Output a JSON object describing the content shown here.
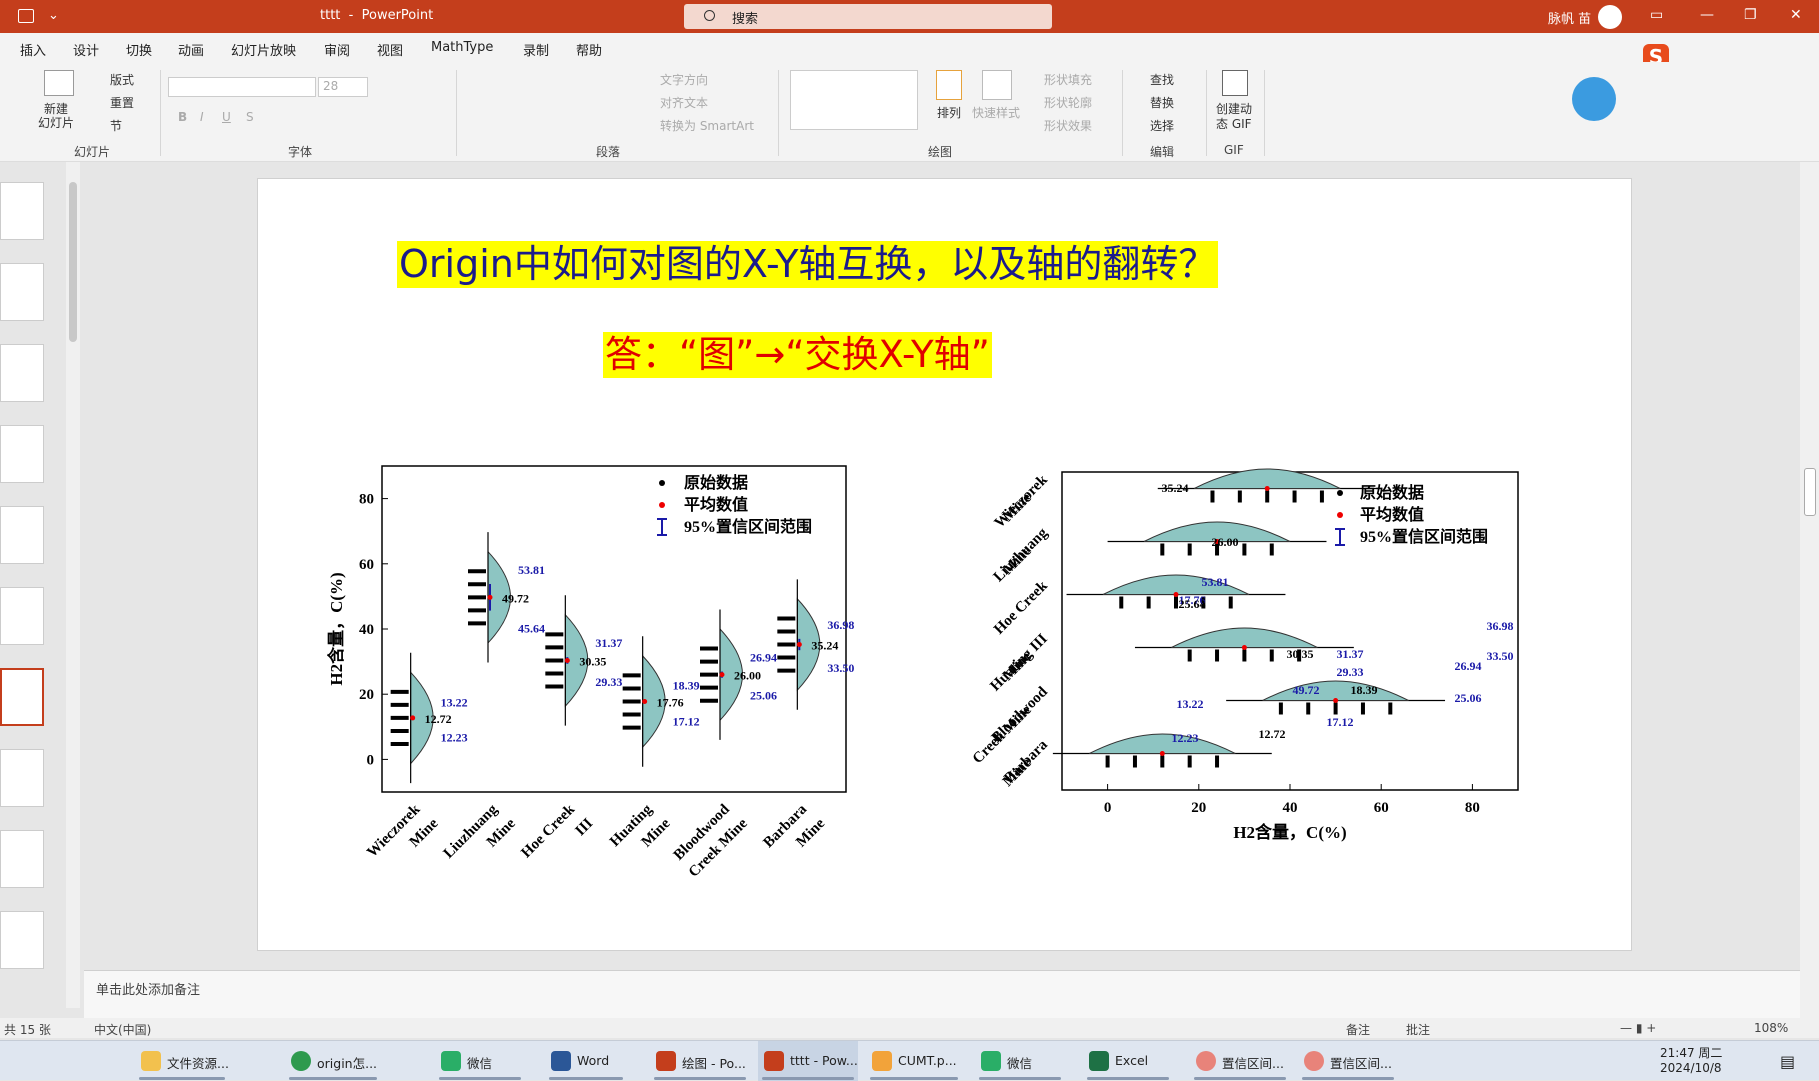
{
  "titlebar": {
    "doc_title": "tttt  -  PowerPoint",
    "search_placeholder": "搜索",
    "user_name": "脉帆 苗"
  },
  "menu": [
    "插入",
    "设计",
    "切换",
    "动画",
    "幻灯片放映",
    "审阅",
    "视图",
    "MathType",
    "录制",
    "帮助"
  ],
  "ribbon": {
    "groups": [
      "幻灯片",
      "字体",
      "段落",
      "绘图",
      "编辑",
      "GIF"
    ],
    "new_slide": "新建\n幻灯片",
    "layout": "版式",
    "reset": "重置",
    "section": "节",
    "font_size": "28",
    "text_direction": "文字方向",
    "align_text": "对齐文本",
    "convert_smartart": "转换为 SmartArt",
    "arrange": "排列",
    "quick_styles": "快速样式",
    "shape_fill": "形状填充",
    "shape_outline": "形状轮廓",
    "shape_effects": "形状效果",
    "find": "查找",
    "replace": "替换",
    "select": "选择",
    "gif": "创建动\n态 GIF"
  },
  "slide": {
    "title": "Origin中如何对图的X-Y轴互换，以及轴的翻转？",
    "answer": "答：“图”→“交换X-Y轴”"
  },
  "chart_data": [
    {
      "type": "violin",
      "categories": [
        "Wieczorek\nMine",
        "Liuzhuang\nMine",
        "Hoe Creek\nIII",
        "Huating\nMine",
        "Bloodwood\nCreek Mine",
        "Barbara\nMine"
      ],
      "ylabel": "H2含量，C(%)",
      "ylim": [
        -10,
        90
      ],
      "yticks": [
        0,
        20,
        40,
        60,
        80
      ],
      "legend": [
        "原始数据",
        "平均数值",
        "95%置信区间范围"
      ],
      "means": [
        12.72,
        49.72,
        30.35,
        17.76,
        26.0,
        35.24
      ],
      "ci_upper": [
        13.22,
        53.81,
        31.37,
        18.39,
        26.94,
        36.98
      ],
      "ci_lower": [
        12.23,
        45.64,
        29.33,
        17.12,
        25.06,
        33.5
      ]
    },
    {
      "type": "violin",
      "orientation": "horizontal",
      "categories": [
        "Wieczorek\nMine",
        "Liuzhuang\nMine",
        "Hoe Creek",
        "Huating III\nMine",
        "Bloodwood\nCreek Mine",
        "Barbara\nMine"
      ],
      "xlabel": "H2含量，C(%)",
      "xlim": [
        -10,
        90
      ],
      "xticks": [
        0,
        20,
        40,
        60,
        80
      ],
      "legend": [
        "原始数据",
        "平均数值",
        "95%置信区间范围"
      ],
      "labels": [
        "35.24",
        "26.00",
        "53.81",
        "17.76",
        "25.64",
        "30.35",
        "31.37",
        "29.33",
        "49.72",
        "18.39",
        "17.12",
        "12.72",
        "13.22",
        "12.23",
        "36.98",
        "33.50",
        "26.94",
        "25.06"
      ]
    }
  ],
  "notes": "单击此处添加备注",
  "status": {
    "slides": "共 15 张",
    "lang": "中文(中国)",
    "notes_btn": "备注",
    "comments_btn": "批注",
    "zoom": "108%"
  },
  "taskbar": {
    "items": [
      "文件资源...",
      "origin怎...",
      "微信",
      "Word",
      "绘图 - Po...",
      "tttt - Pow...",
      "CUMT.p...",
      "微信",
      "Excel",
      "置信区间...",
      "置信区间..."
    ],
    "time": "21:47 周二",
    "date": "2024/10/8"
  }
}
